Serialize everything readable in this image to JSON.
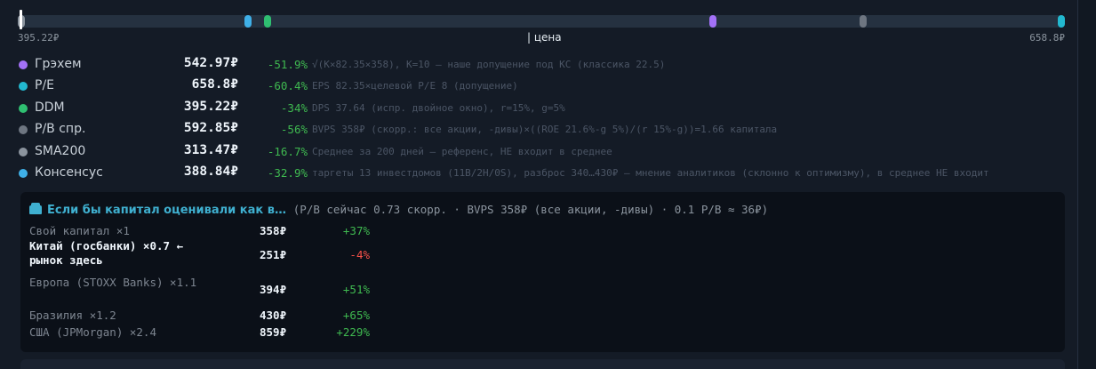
{
  "colors": {
    "graham": "#a371f7",
    "pe": "#22b8cf",
    "ddm": "#2fbf71",
    "pb": "#6e7681",
    "sma": "#8b949e",
    "consensus": "#3fb0e8",
    "price": "#ffffff"
  },
  "range": {
    "min_label": "395.22₽",
    "max_label": "658.8₽",
    "price_label": "цена",
    "min_value": 313.47,
    "max_value": 658.8,
    "price_value": 313.47
  },
  "methods": [
    {
      "name": "Грэхем",
      "value": 542.97,
      "value_label": "542.97₽",
      "delta": "-51.9%",
      "note": "√(K×82.35×358), K=10 — наше допущение под КС (классика 22.5)",
      "color_key": "graham",
      "icon": "circle-icon"
    },
    {
      "name": "P/E",
      "value": 658.8,
      "value_label": "658.8₽",
      "delta": "-60.4%",
      "note": "EPS 82.35×целевой P/E 8 (допущение)",
      "color_key": "pe",
      "icon": "circle-icon"
    },
    {
      "name": "DDM",
      "value": 395.22,
      "value_label": "395.22₽",
      "delta": "-34%",
      "note": "DPS 37.64 (испр. двойное окно), r=15%, g=5%",
      "color_key": "ddm",
      "icon": "circle-icon"
    },
    {
      "name": "P/B спр.",
      "value": 592.85,
      "value_label": "592.85₽",
      "delta": "-56%",
      "note": "BVPS 358₽ (скорр.: все акции, -дивы)×((ROE 21.6%-g 5%)/(r 15%-g))=1.66 капитала",
      "color_key": "pb",
      "icon": "circle-icon"
    },
    {
      "name": "SMA200",
      "value": 313.47,
      "value_label": "313.47₽",
      "delta": "-16.7%",
      "note": "Среднее за 200 дней — референс, НЕ входит в среднее",
      "color_key": "sma",
      "icon": "circle-icon"
    },
    {
      "name": "Консенсус",
      "value": 388.84,
      "value_label": "388.84₽",
      "delta": "-32.9%",
      "note": "таргеты 13 инвестдомов (11B/2H/0S), разброс 340…430₽ — мнение аналитиков (склонно к оптимизму), в среднее НЕ входит",
      "color_key": "consensus",
      "icon": "circle-icon"
    }
  ],
  "capital": {
    "title": "Если бы капитал оценивали как в…",
    "subtitle": "(P/B сейчас 0.73 скорр. · BVPS 358₽ (все акции, -дивы) · 0.1 P/B ≈ 36₽)",
    "icon": "bank-icon",
    "rows": [
      {
        "name": "Свой капитал ×1",
        "value": "358₽",
        "delta": "+37%",
        "highlight": false,
        "negative": false
      },
      {
        "name": "Китай (госбанки) ×0.7 ← рынок здесь",
        "value": "251₽",
        "delta": "-4%",
        "highlight": true,
        "negative": true
      },
      {
        "name": "Европа (STOXX Banks) ×1.1",
        "value": "394₽",
        "delta": "+51%",
        "highlight": false,
        "negative": false
      },
      {
        "name": "Бразилия ×1.2",
        "value": "430₽",
        "delta": "+65%",
        "highlight": false,
        "negative": false
      },
      {
        "name": "США (JPMorgan) ×2.4",
        "value": "859₽",
        "delta": "+229%",
        "highlight": false,
        "negative": false
      }
    ]
  }
}
